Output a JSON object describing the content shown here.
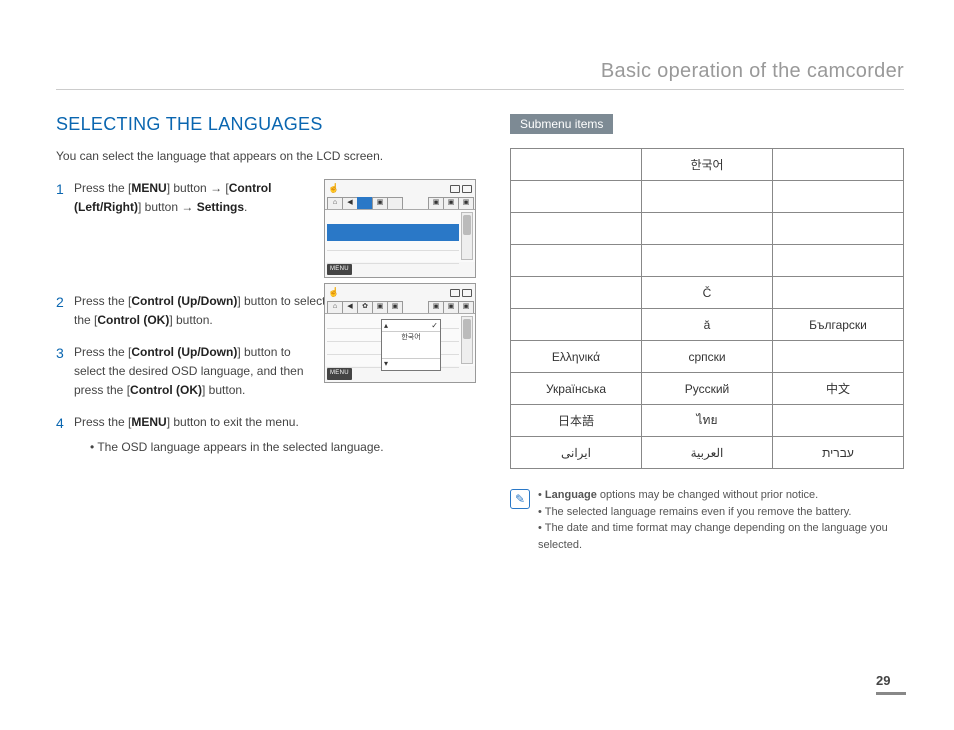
{
  "header": {
    "title": "Basic operation of the camcorder"
  },
  "left": {
    "section_title": "SELECTING THE LANGUAGES",
    "intro": "You can select the language that appears on the LCD screen.",
    "steps": [
      {
        "n": "1",
        "html": "Press the [<b>MENU</b>] button → [<b>Control (Left/Right)</b>] button → <b>Settings</b>."
      },
      {
        "n": "2",
        "html": "Press the [<b>Control (Up/Down)</b>] button to select <b>Language</b>, and then press the [<b>Control (OK)</b>] button."
      },
      {
        "n": "3",
        "html": "Press the [<b>Control (Up/Down)</b>] button to select the desired OSD language, and then press the [<b>Control (OK)</b>] button."
      },
      {
        "n": "4",
        "html": "Press the [<b>MENU</b>] button to exit the menu."
      }
    ],
    "step4_sub": "The OSD language appears in the selected language.",
    "lcd": {
      "menu_label": "MENU",
      "dropdown_item": "한국어"
    }
  },
  "right": {
    "submenu_label": "Submenu items",
    "table": [
      [
        "",
        "한국어",
        ""
      ],
      [
        "",
        "",
        ""
      ],
      [
        "",
        "",
        ""
      ],
      [
        "",
        "",
        ""
      ],
      [
        "",
        "Č",
        ""
      ],
      [
        "",
        "ă",
        "Български"
      ],
      [
        "Ελληνικά",
        "српски",
        ""
      ],
      [
        "Українська",
        "Русский",
        "中文"
      ],
      [
        "日本語",
        "ไทย",
        ""
      ],
      [
        "ایرانی",
        "العربية",
        "עברית"
      ]
    ],
    "notes": [
      "<b>Language</b> options may be changed without prior notice.",
      "The selected language remains even if you remove the battery.",
      "The date and time format may change depending on the language you selected."
    ]
  },
  "page_number": "29"
}
